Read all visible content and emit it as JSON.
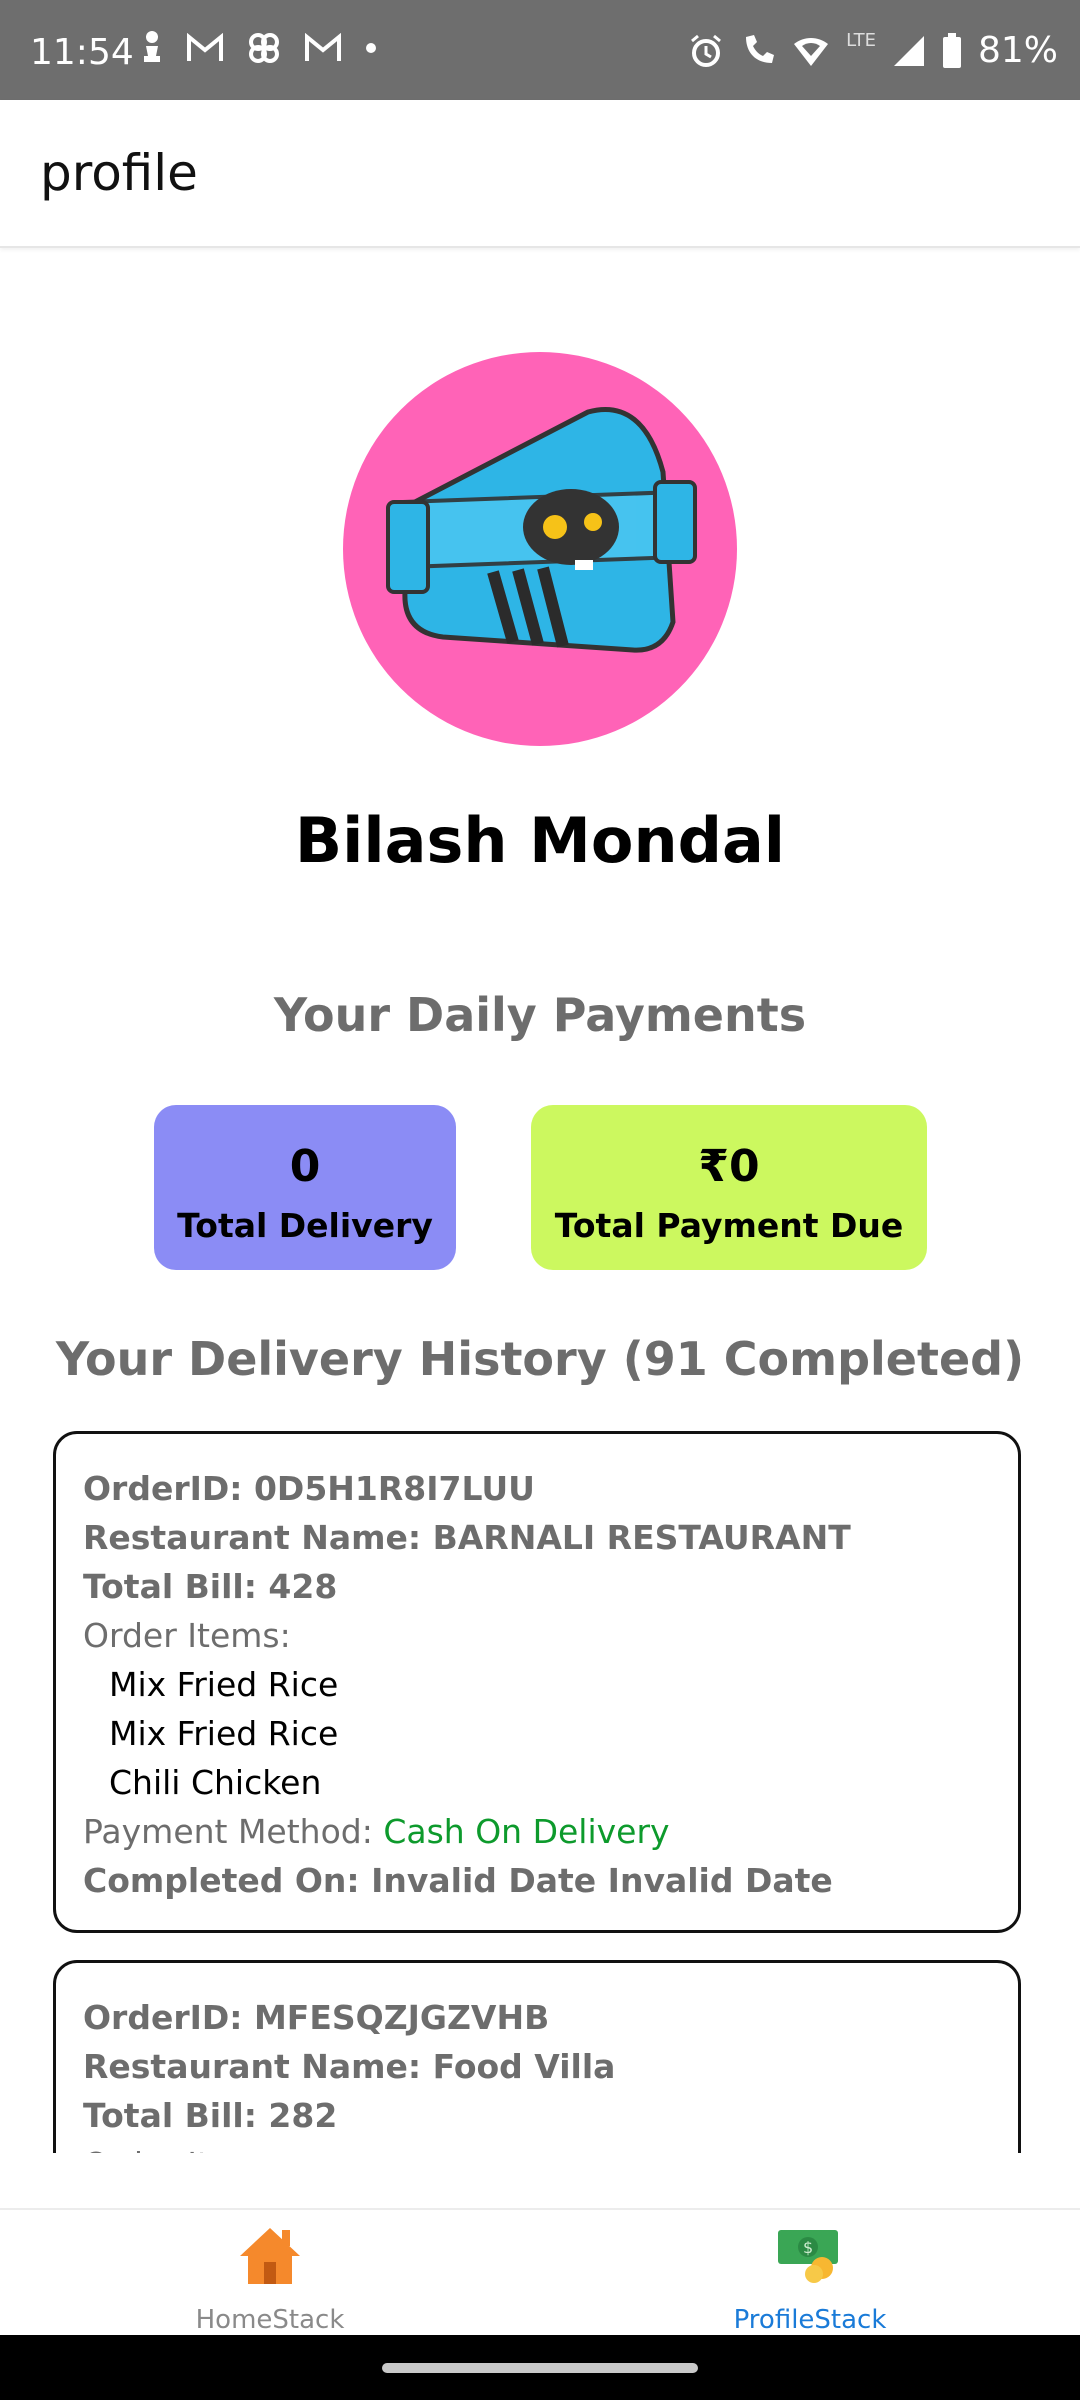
{
  "status_bar": {
    "time": "11:54",
    "battery": "81%",
    "lte": "LTE"
  },
  "app_bar": {
    "title": "profile"
  },
  "profile": {
    "name": "Bilash Mondal",
    "avatar_bg": "#ff63b7"
  },
  "daily_payments": {
    "title": "Your Daily Payments",
    "total_delivery_value": "0",
    "total_delivery_label": "Total Delivery",
    "total_payment_value": "₹0",
    "total_payment_label": "Total Payment Due"
  },
  "history": {
    "title": "Your Delivery History (91 Completed)",
    "orders": [
      {
        "order_id": "OrderID: 0D5H1R8I7LUU",
        "restaurant": "Restaurant Name: BARNALI RESTAURANT",
        "total_bill": "Total Bill: 428",
        "items_label": "Order Items:",
        "items": [
          "Mix Fried Rice",
          "Mix Fried Rice",
          "Chili Chicken"
        ],
        "payment_label": "Payment Method: ",
        "payment_value": "Cash On Delivery",
        "completed": "Completed On: Invalid Date Invalid Date"
      },
      {
        "order_id": "OrderID: MFESQZJGZVHB",
        "restaurant": "Restaurant Name: Food Villa",
        "total_bill": "Total Bill: 282",
        "items_label": "Order Items:"
      }
    ]
  },
  "tabs": {
    "home": "HomeStack",
    "profile": "ProfileStack"
  },
  "colors": {
    "delivery_card": "#8b8cf5",
    "payment_card": "#ccf85f",
    "active_tab": "#1a7bd8",
    "payment_method": "#0d9a2c"
  }
}
